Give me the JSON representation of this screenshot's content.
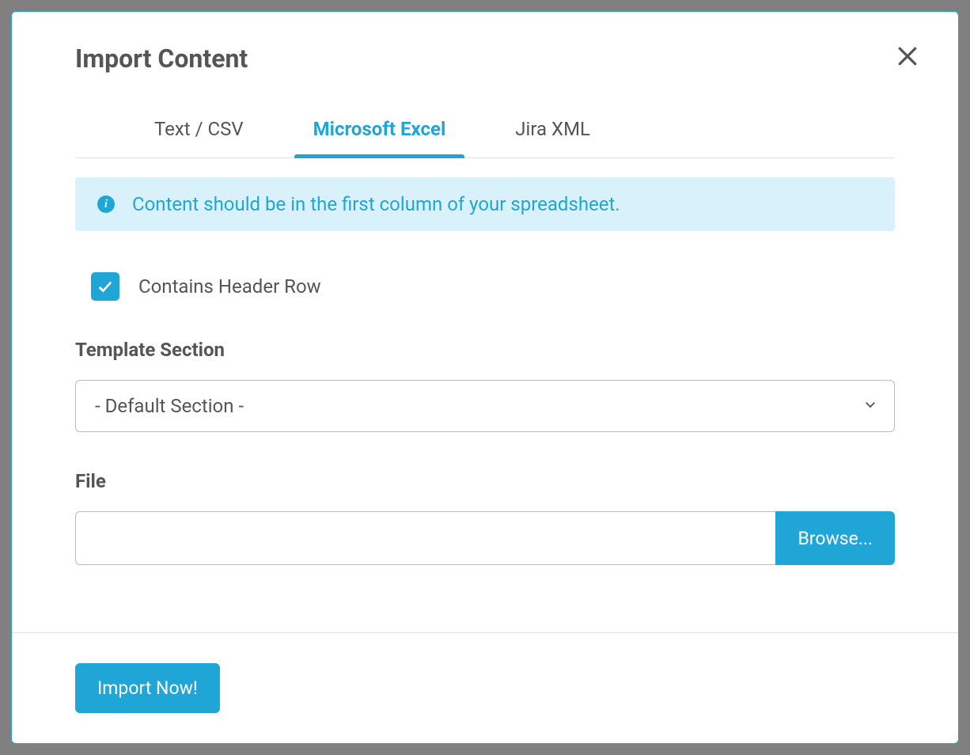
{
  "modal": {
    "title": "Import Content",
    "tabs": [
      {
        "label": "Text / CSV",
        "active": false
      },
      {
        "label": "Microsoft Excel",
        "active": true
      },
      {
        "label": "Jira XML",
        "active": false
      }
    ],
    "info_text": "Content should be in the first column of your spreadsheet.",
    "checkbox": {
      "checked": true,
      "label": "Contains Header Row"
    },
    "template_section": {
      "label": "Template Section",
      "selected": "- Default Section -"
    },
    "file": {
      "label": "File",
      "value": "",
      "browse_label": "Browse..."
    },
    "import_button_label": "Import Now!"
  }
}
